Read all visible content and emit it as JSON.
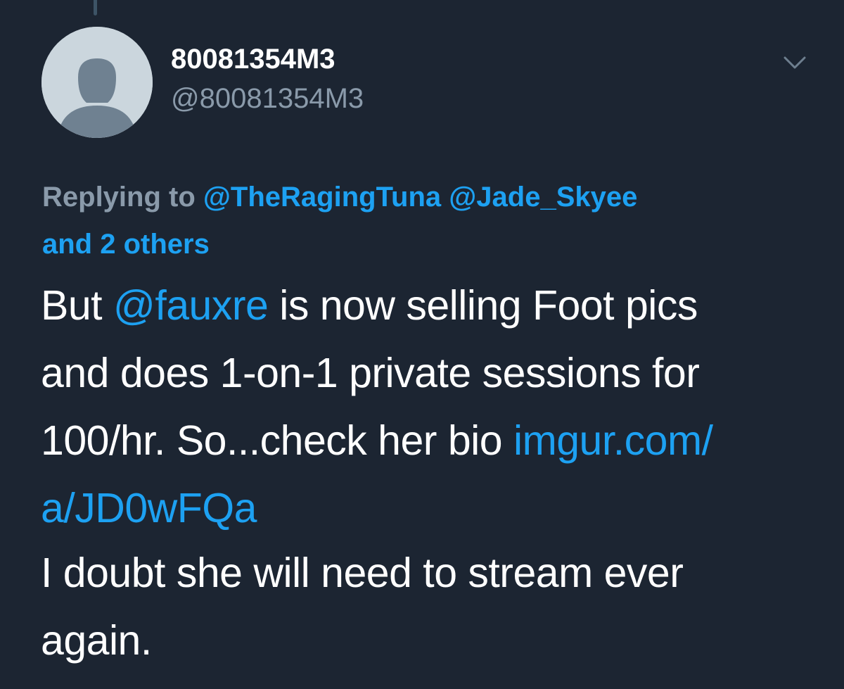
{
  "author": {
    "display_name": "80081354M3",
    "handle": "@80081354M3",
    "avatar_icon": "default-avatar-icon"
  },
  "menu_icon": "chevron-down-icon",
  "reply": {
    "prefix": "Replying to",
    "mention_1": "@TheRagingTuna",
    "mention_2": "@Jade_Skyee",
    "others": "and 2 others"
  },
  "tweet": {
    "line1_pre": "But ",
    "line1_mention": "@fauxre",
    "line1_post": " is now selling Foot pics",
    "line2": "and does 1-on-1 private sessions for",
    "line3_pre": "100/hr. So...check her bio ",
    "line3_link": "imgur.com/",
    "line4_link": "a/JD0wFQa",
    "line5": "I doubt she will need to stream ever",
    "line6": "again."
  },
  "colors": {
    "background": "#1c2532",
    "link": "#1da1f2",
    "muted": "#8a9aaa",
    "text": "#ffffff"
  }
}
